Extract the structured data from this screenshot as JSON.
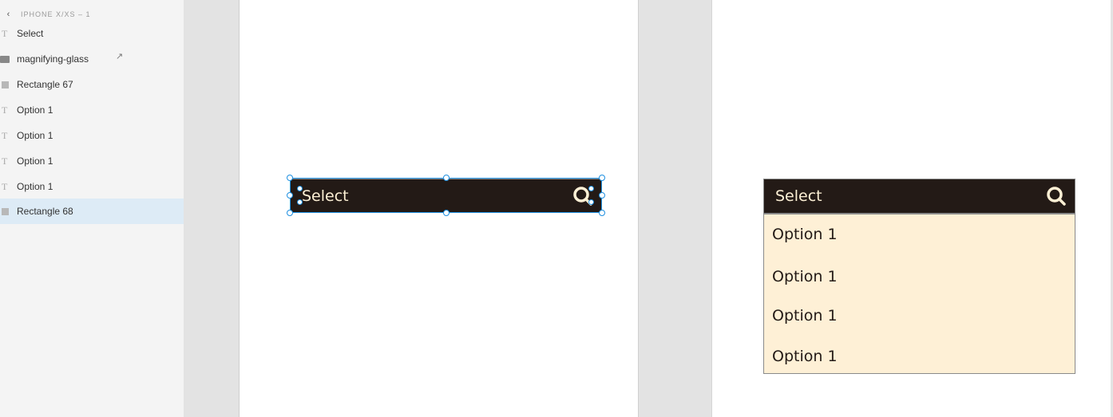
{
  "layers_panel": {
    "artboard_title": "IPHONE X/XS – 1",
    "items": [
      {
        "label": "Select",
        "type": "text"
      },
      {
        "label": "magnifying-glass",
        "type": "group"
      },
      {
        "label": "Rectangle 67",
        "type": "rectangle"
      },
      {
        "label": "Option 1",
        "type": "text"
      },
      {
        "label": "Option 1",
        "type": "text"
      },
      {
        "label": "Option 1",
        "type": "text"
      },
      {
        "label": "Option 1",
        "type": "text"
      },
      {
        "label": "Rectangle 68",
        "type": "rectangle",
        "selected": true
      }
    ]
  },
  "artboard1": {
    "select_label": "Select"
  },
  "artboard2": {
    "select_label": "Select",
    "options": [
      "Option 1",
      "Option 1",
      "Option 1",
      "Option 1"
    ]
  },
  "colors": {
    "header_bg": "#231a16",
    "header_text": "#fdf0d5",
    "dropdown_bg": "#fef0d6",
    "selection": "#1e8fe0"
  }
}
